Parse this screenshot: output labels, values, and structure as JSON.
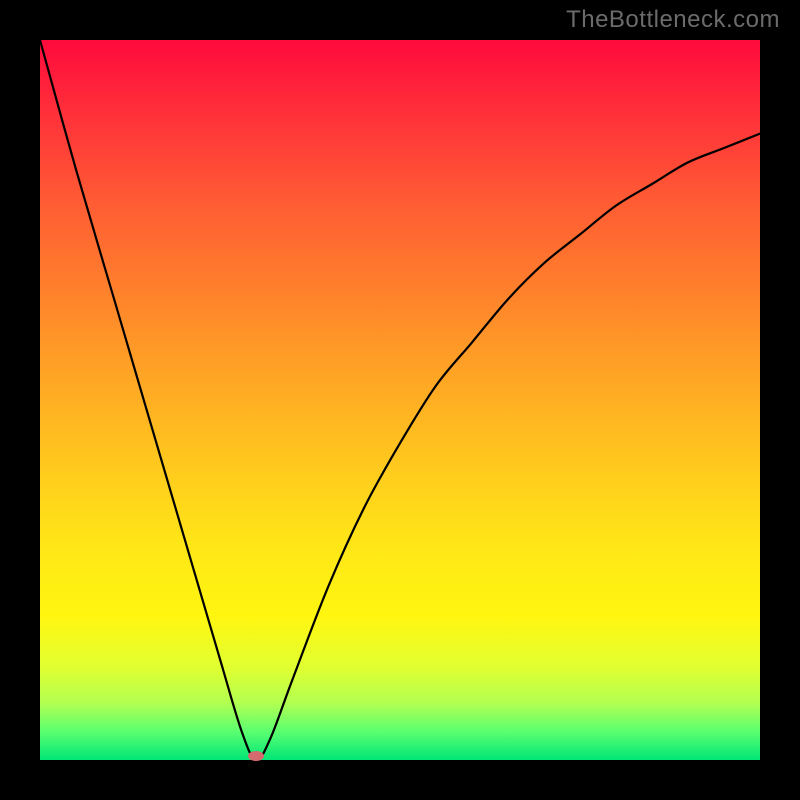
{
  "watermark": "TheBottleneck.com",
  "chart_data": {
    "type": "line",
    "title": "",
    "xlabel": "",
    "ylabel": "",
    "xlim": [
      0,
      100
    ],
    "ylim": [
      0,
      100
    ],
    "grid": false,
    "legend": "none",
    "series": [
      {
        "name": "bottleneck-curve",
        "x": [
          0,
          5,
          10,
          15,
          20,
          25,
          28,
          30,
          32,
          35,
          40,
          45,
          50,
          55,
          60,
          65,
          70,
          75,
          80,
          85,
          90,
          95,
          100
        ],
        "values": [
          100,
          82,
          65,
          48,
          31,
          14,
          4,
          0,
          3,
          11,
          24,
          35,
          44,
          52,
          58,
          64,
          69,
          73,
          77,
          80,
          83,
          85,
          87
        ]
      }
    ],
    "annotations": [
      {
        "type": "point",
        "name": "minimum",
        "x": 30,
        "y": 0,
        "color": "#d56a6f"
      }
    ],
    "background": {
      "type": "vertical-gradient",
      "description": "green (good) at y=0 through yellow/orange to red (bad) at y=100",
      "stops": [
        {
          "y": 0,
          "color": "#00e676"
        },
        {
          "y": 8,
          "color": "#b3ff50"
        },
        {
          "y": 20,
          "color": "#fff610"
        },
        {
          "y": 42,
          "color": "#ffc61e"
        },
        {
          "y": 66,
          "color": "#ff7e2c"
        },
        {
          "y": 90,
          "color": "#ff2f3a"
        },
        {
          "y": 100,
          "color": "#ff0a3c"
        }
      ]
    }
  }
}
